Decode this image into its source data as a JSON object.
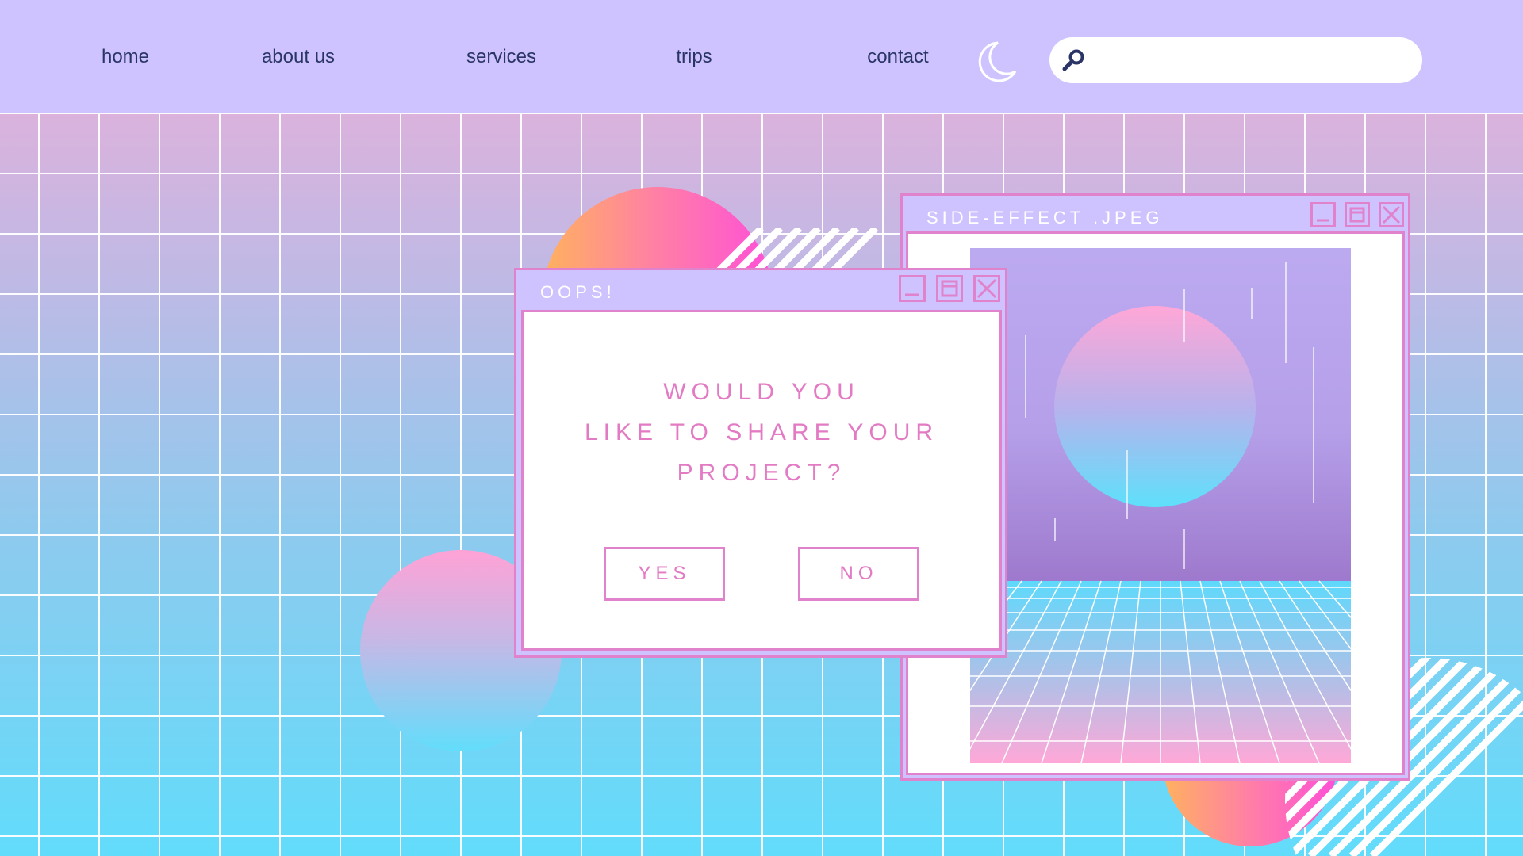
{
  "nav": {
    "links": [
      "home",
      "about us",
      "services",
      "trips",
      "contact"
    ],
    "theme_toggle_icon": "crescent-moon-icon",
    "search": {
      "icon": "magnifier-icon",
      "placeholder": "",
      "value": ""
    }
  },
  "windows": {
    "dialog": {
      "title": "OOPS!",
      "message_lines": [
        "WOULD YOU",
        "LIKE TO SHARE YOUR",
        "PROJECT?"
      ],
      "yes_label": "YES",
      "no_label": "NO",
      "controls": [
        "minimize-icon",
        "maximize-icon",
        "close-icon"
      ]
    },
    "image_window": {
      "title": "SIDE-EFFECT .JPEG",
      "controls": [
        "minimize-icon",
        "maximize-icon",
        "close-icon"
      ]
    }
  },
  "colors": {
    "nav_background": "#cec3ff",
    "nav_text": "#2a3566",
    "window_border": "#e083cc",
    "dialog_text": "#e27bc3",
    "background_top": "#ecaed6",
    "background_bottom": "#62dcfb"
  }
}
